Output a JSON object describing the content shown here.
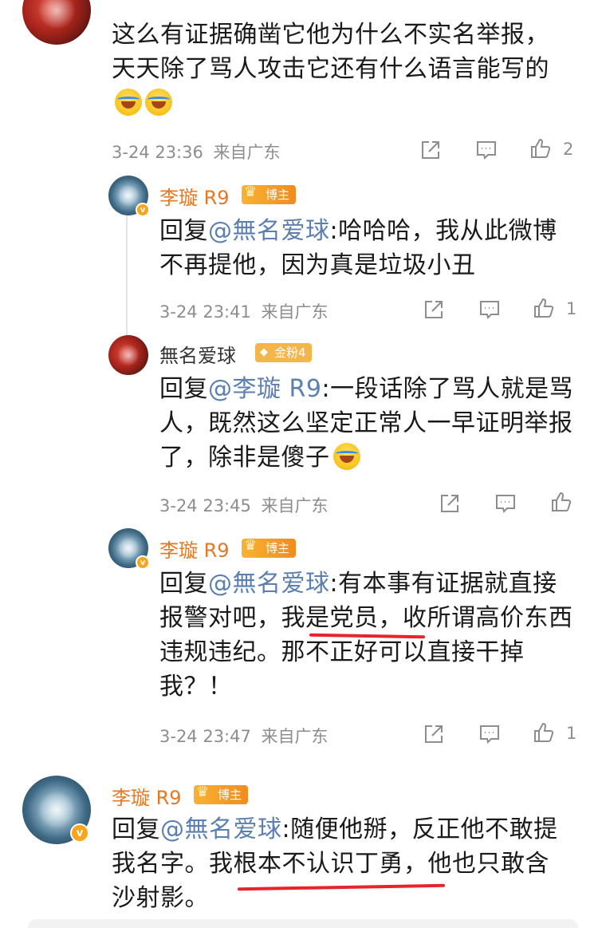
{
  "comments": [
    {
      "text": "这么有证据确凿它他为什么不实名举报，天天除了骂人攻击它还有什么语言能写的",
      "time": "3-24 23:36",
      "source": "来自广东",
      "likes": "2"
    },
    {
      "username": "李璇 R9",
      "badge": "博主",
      "reply_prefix": "回复",
      "mention": "@無名爱球",
      "text": ":哈哈哈，我从此微博不再提他，因为真是垃圾小丑",
      "time": "3-24 23:41",
      "source": "来自广东",
      "likes": "1"
    },
    {
      "username": "無名爱球",
      "badge": "金粉4",
      "reply_prefix": "回复",
      "mention": "@李璇 R9",
      "text": ":一段话除了骂人就是骂人，既然这么坚定正常人一早证明举报了，除非是傻子",
      "time": "3-24 23:45",
      "source": "来自广东",
      "likes": ""
    },
    {
      "username": "李璇 R9",
      "badge": "博主",
      "reply_prefix": "回复",
      "mention": "@無名爱球",
      "text": ":有本事有证据就直接报警对吧，我是党员，收所谓高价东西违规违纪。那不正好可以直接干掉我？！",
      "time": "3-24 23:47",
      "source": "来自广东",
      "likes": "1"
    },
    {
      "username": "李璇 R9",
      "badge": "博主",
      "reply_prefix": "回复",
      "mention": "@無名爱球",
      "text": ":随便他掰，反正他不敢提我名字。我根本不认识丁勇，他也只敢含沙射影。"
    }
  ],
  "icons": {
    "share": "share-icon",
    "comment": "comment-icon",
    "like": "thumbs-up-icon",
    "verified": "verified-v-icon"
  },
  "colors": {
    "username": "#e87722",
    "mention": "#5b7fb0",
    "meta": "#8d8d8d",
    "highlight_underline": "#e8232b"
  }
}
